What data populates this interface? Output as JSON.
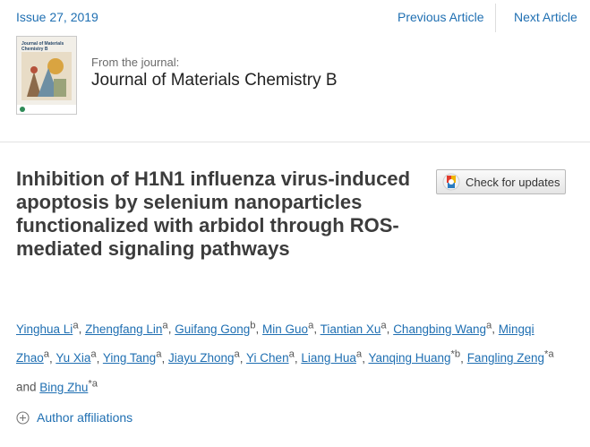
{
  "header": {
    "issue": "Issue 27, 2019",
    "prev_label": "Previous Article",
    "next_label": "Next Article"
  },
  "journal": {
    "from_label": "From the journal:",
    "name": "Journal of Materials Chemistry B",
    "cover_title": "Journal of Materials Chemistry B"
  },
  "article": {
    "title": "Inhibition of H1N1 influenza virus-induced apoptosis by selenium nanoparticles functionalized with arbidol through ROS-mediated signaling pathways",
    "check_updates_label": "Check for updates",
    "authors": [
      {
        "name": "Yinghua Li",
        "sup": "a"
      },
      {
        "name": "Zhengfang Lin",
        "sup": "a"
      },
      {
        "name": "Guifang Gong",
        "sup": "b"
      },
      {
        "name": "Min Guo",
        "sup": "a"
      },
      {
        "name": "Tiantian Xu",
        "sup": "a"
      },
      {
        "name": "Changbing Wang",
        "sup": "a"
      },
      {
        "name": "Mingqi Zhao",
        "sup": "a"
      },
      {
        "name": "Yu Xia",
        "sup": "a"
      },
      {
        "name": "Ying Tang",
        "sup": "a"
      },
      {
        "name": "Jiayu Zhong",
        "sup": "a"
      },
      {
        "name": "Yi Chen",
        "sup": "a"
      },
      {
        "name": "Liang Hua",
        "sup": "a"
      },
      {
        "name": "Yanqing Huang",
        "sup": "*b"
      },
      {
        "name": "Fangling Zeng",
        "sup": "*a"
      },
      {
        "name": "Bing Zhu",
        "sup": "*a"
      }
    ],
    "and_text": "and",
    "affiliations_label": "Author affiliations"
  },
  "colors": {
    "link": "#1f6fb2",
    "title": "#3c3c3c"
  },
  "icons": [
    "crossmark-icon",
    "plus-circle-icon"
  ]
}
